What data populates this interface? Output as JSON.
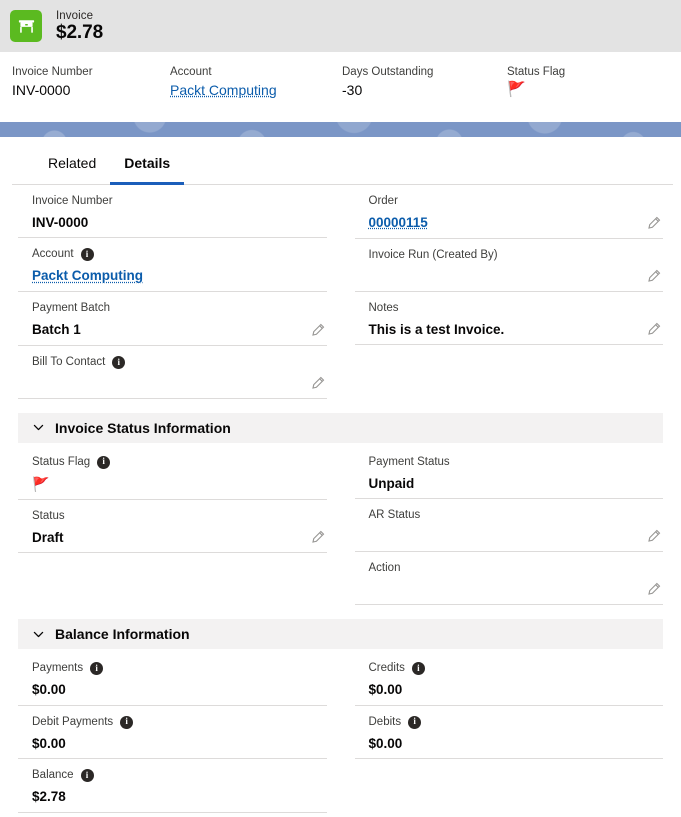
{
  "header": {
    "icon_name": "invoice-app-icon",
    "icon_color": "#5bba20",
    "eyebrow": "Invoice",
    "title": "$2.78",
    "highlights": [
      {
        "label": "Invoice Number",
        "value": "INV-0000",
        "type": "text"
      },
      {
        "label": "Account",
        "value": "Packt Computing",
        "type": "link"
      },
      {
        "label": "Days Outstanding",
        "value": "-30",
        "type": "text"
      },
      {
        "label": "Status Flag",
        "value": "🚩",
        "type": "flag"
      }
    ]
  },
  "tabs": [
    {
      "label": "Related",
      "active": false
    },
    {
      "label": "Details",
      "active": true
    }
  ],
  "details": {
    "left": [
      {
        "label": "Invoice Number",
        "value": "INV-0000",
        "info": false,
        "edit": false,
        "type": "text"
      },
      {
        "label": "Account",
        "value": "Packt Computing",
        "info": true,
        "edit": false,
        "type": "link"
      },
      {
        "label": "Payment Batch",
        "value": "Batch 1",
        "info": false,
        "edit": true,
        "type": "text"
      },
      {
        "label": "Bill To Contact",
        "value": "",
        "info": true,
        "edit": true,
        "type": "text"
      }
    ],
    "right": [
      {
        "label": "Order",
        "value": "00000115",
        "info": false,
        "edit": true,
        "type": "link"
      },
      {
        "label": "Invoice Run (Created By)",
        "value": "",
        "info": false,
        "edit": true,
        "type": "text"
      },
      {
        "label": "Notes",
        "value": "This is a test Invoice.",
        "info": false,
        "edit": true,
        "type": "text"
      }
    ]
  },
  "status_section": {
    "title": "Invoice Status Information",
    "collapsed": false,
    "left": [
      {
        "label": "Status Flag",
        "value": "🚩",
        "info": true,
        "edit": false,
        "type": "flag"
      },
      {
        "label": "Status",
        "value": "Draft",
        "info": false,
        "edit": true,
        "type": "text"
      }
    ],
    "right": [
      {
        "label": "Payment Status",
        "value": "Unpaid",
        "info": false,
        "edit": false,
        "type": "text"
      },
      {
        "label": "AR Status",
        "value": "",
        "info": false,
        "edit": true,
        "type": "text"
      },
      {
        "label": "Action",
        "value": "",
        "info": false,
        "edit": true,
        "type": "text"
      }
    ]
  },
  "balance_section": {
    "title": "Balance Information",
    "collapsed": false,
    "left": [
      {
        "label": "Payments",
        "value": "$0.00",
        "info": true,
        "edit": false,
        "type": "text"
      },
      {
        "label": "Debit Payments",
        "value": "$0.00",
        "info": true,
        "edit": false,
        "type": "text"
      },
      {
        "label": "Balance",
        "value": "$2.78",
        "info": true,
        "edit": false,
        "type": "text"
      }
    ],
    "right": [
      {
        "label": "Credits",
        "value": "$0.00",
        "info": true,
        "edit": false,
        "type": "text"
      },
      {
        "label": "Debits",
        "value": "$0.00",
        "info": true,
        "edit": false,
        "type": "text"
      }
    ]
  },
  "colors": {
    "accent_blue": "#1b5eba",
    "link_blue": "#0b5cab",
    "brand_green": "#5bba20",
    "band_blue": "#7b96c6",
    "section_bg": "#f3f2f2"
  }
}
